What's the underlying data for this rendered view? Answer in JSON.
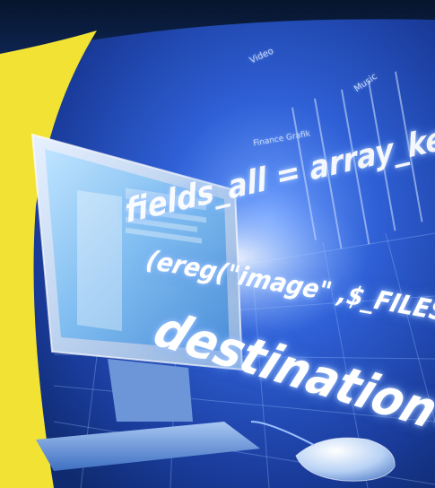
{
  "scene": {
    "code_lines": [
      "fields_all = array_keys($lab",
      "(ereg(\"image\" ,$_FILES['pix",
      "destination='c:"
    ],
    "overlay_labels": {
      "video": "Video",
      "music": "Music",
      "finance": "Finance  Grafik"
    },
    "colors": {
      "background_blue": "#1d47b3",
      "dark_top": "#0b1a33",
      "yellow_band": "#f2e233",
      "monitor_glow": "#9fd0ff"
    },
    "objects": [
      "crt-monitor",
      "computer-mouse",
      "php-code-overlay"
    ]
  }
}
